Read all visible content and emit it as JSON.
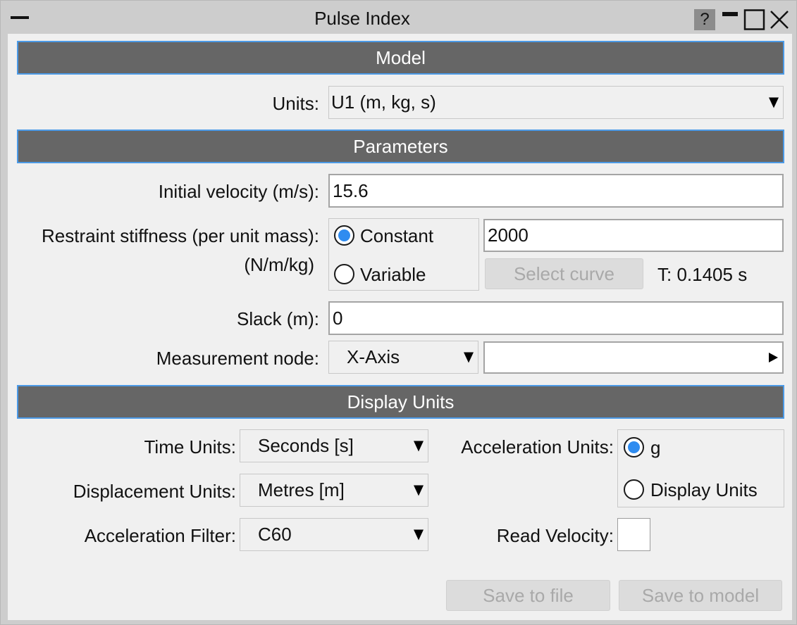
{
  "window": {
    "title": "Pulse Index",
    "help_label": "?"
  },
  "sections": {
    "model": "Model",
    "parameters": "Parameters",
    "display_units": "Display Units"
  },
  "model": {
    "units_label": "Units:",
    "units_value": "U1 (m, kg, s)"
  },
  "parameters": {
    "initial_velocity_label": "Initial velocity (m/s):",
    "initial_velocity_value": "15.6",
    "restraint_label_line1": "Restraint stiffness (per unit mass):",
    "restraint_label_line2": "(N/m/kg)",
    "constant_label": "Constant",
    "variable_label": "Variable",
    "stiffness_mode": "Constant",
    "stiffness_value": "2000",
    "select_curve_label": "Select curve",
    "period_text": "T: 0.1405 s",
    "slack_label": "Slack (m):",
    "slack_value": "0",
    "measurement_node_label": "Measurement node:",
    "measurement_node_axis": "X-Axis",
    "measurement_node_value": ""
  },
  "display_units": {
    "time_units_label": "Time Units:",
    "time_units_value": "Seconds [s]",
    "displacement_units_label": "Displacement Units:",
    "displacement_units_value": "Metres [m]",
    "acceleration_filter_label": "Acceleration Filter:",
    "acceleration_filter_value": "C60",
    "acceleration_units_label": "Acceleration Units:",
    "acceleration_g_label": "g",
    "acceleration_display_label": "Display Units",
    "acceleration_units_selected": "g",
    "read_velocity_label": "Read Velocity:",
    "read_velocity_checked": false
  },
  "footer": {
    "save_file_label": "Save to file",
    "save_model_label": "Save to model"
  },
  "colors": {
    "section_bar": "#666666",
    "section_border": "#4c9ae6",
    "radio_selected": "#2f8cf0"
  }
}
